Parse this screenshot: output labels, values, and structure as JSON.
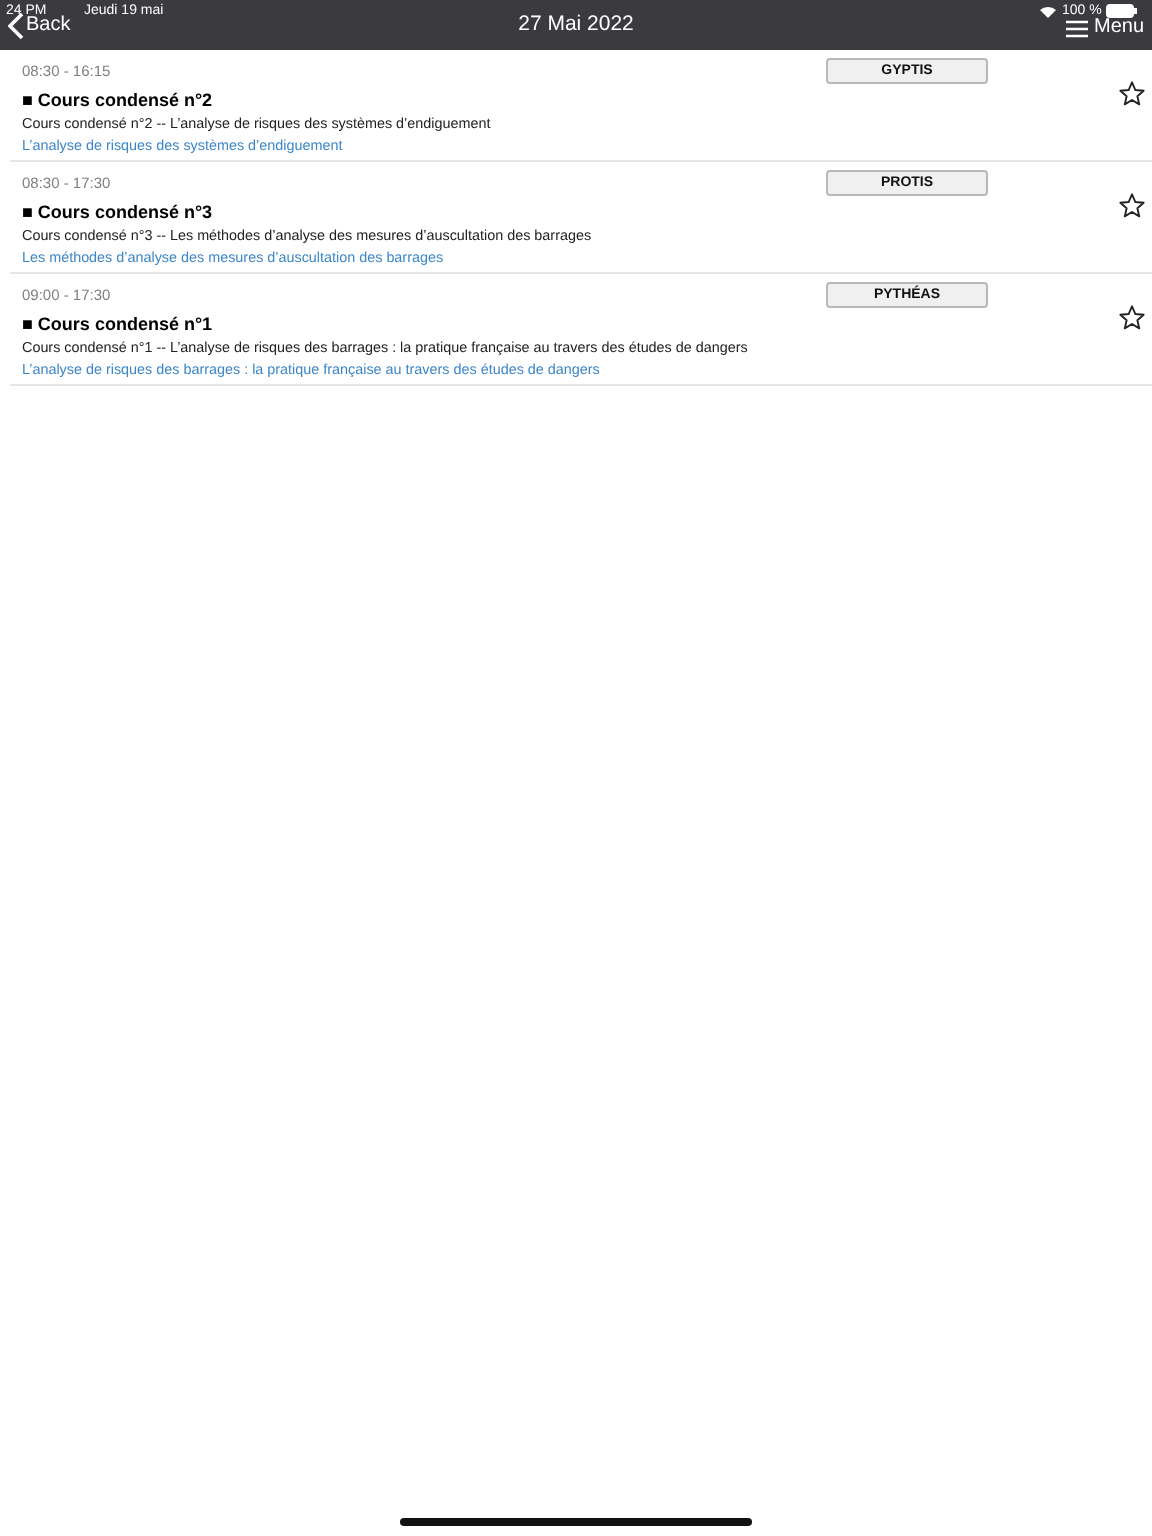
{
  "status_bar": {
    "time": "24 PM",
    "date": "Jeudi 19 mai",
    "battery": "100 %"
  },
  "nav_bar": {
    "back": "Back",
    "title": "27 Mai 2022",
    "menu": "Menu"
  },
  "sessions": [
    {
      "time": "08:30 - 16:15",
      "room": "GYPTIS",
      "bullet": "■",
      "title": "Cours condensé n°2",
      "description": "Cours condensé n°2 -- L’analyse de risques des systèmes d’endiguement",
      "link": "L’analyse de risques des systèmes d’endiguement",
      "starred": false
    },
    {
      "time": "08:30 - 17:30",
      "room": "PROTIS",
      "bullet": "■",
      "title": "Cours condensé n°3",
      "description": "Cours condensé n°3 -- Les méthodes d’analyse des mesures d’auscultation des barrages",
      "link": "Les méthodes d’analyse des mesures d’auscultation des barrages",
      "starred": false
    },
    {
      "time": "09:00 - 17:30",
      "room": "PYTHÉAS",
      "bullet": "■",
      "title": "Cours condensé n°1",
      "description": "Cours condensé n°1 -- L’analyse de risques des barrages : la pratique française au travers des études de dangers",
      "link": "L’analyse de risques des barrages : la pratique française au travers des études de dangers",
      "starred": false
    }
  ]
}
